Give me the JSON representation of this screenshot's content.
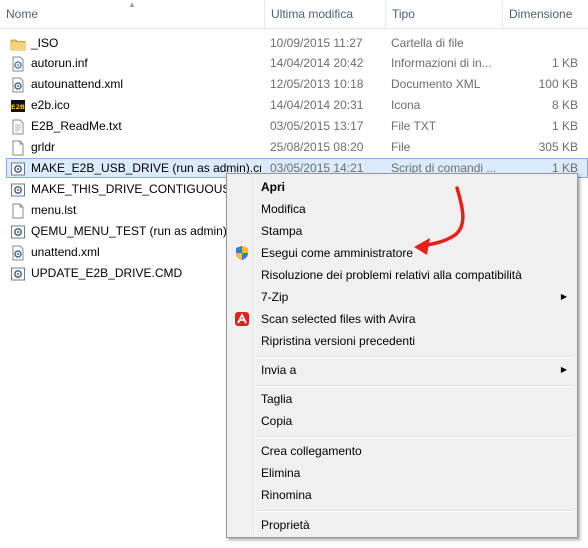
{
  "columns": {
    "name": "Nome",
    "modified": "Ultima modifica",
    "type": "Tipo",
    "size": "Dimensione"
  },
  "files": [
    {
      "name": "_ISO",
      "modified": "10/09/2015 11:27",
      "type": "Cartella di file",
      "size": "",
      "icon": "folder-icon"
    },
    {
      "name": "autorun.inf",
      "modified": "14/04/2014 20:42",
      "type": "Informazioni di in...",
      "size": "1 KB",
      "icon": "settings-file-icon"
    },
    {
      "name": "autounattend.xml",
      "modified": "12/05/2013 10:18",
      "type": "Documento XML",
      "size": "100 KB",
      "icon": "xml-file-icon"
    },
    {
      "name": "e2b.ico",
      "modified": "14/04/2014 20:31",
      "type": "Icona",
      "size": "8 KB",
      "icon": "e2b-ico-icon"
    },
    {
      "name": "E2B_ReadMe.txt",
      "modified": "03/05/2015 13:17",
      "type": "File TXT",
      "size": "1 KB",
      "icon": "text-file-icon"
    },
    {
      "name": "grldr",
      "modified": "25/08/2015 08:20",
      "type": "File",
      "size": "305 KB",
      "icon": "blank-file-icon"
    },
    {
      "name": "MAKE_E2B_USB_DRIVE (run as admin).cmd",
      "modified": "03/05/2015 14:21",
      "type": "Script di comandi ...",
      "size": "1 KB",
      "icon": "cmd-script-icon"
    },
    {
      "name": "MAKE_THIS_DRIVE_CONTIGUOUS.cmd",
      "modified": "",
      "type": "",
      "size": "",
      "icon": "cmd-script-icon"
    },
    {
      "name": "menu.lst",
      "modified": "",
      "type": "",
      "size": "",
      "icon": "blank-file-icon"
    },
    {
      "name": "QEMU_MENU_TEST (run as admin).cmd",
      "modified": "",
      "type": "",
      "size": "",
      "icon": "cmd-script-icon"
    },
    {
      "name": "unattend.xml",
      "modified": "",
      "type": "",
      "size": "",
      "icon": "xml-file-icon"
    },
    {
      "name": "UPDATE_E2B_DRIVE.CMD",
      "modified": "",
      "type": "",
      "size": "",
      "icon": "cmd-script-icon"
    }
  ],
  "context_menu": {
    "open": "Apri",
    "edit": "Modifica",
    "print": "Stampa",
    "run_as_admin": "Esegui come amministratore",
    "troubleshoot": "Risoluzione dei problemi relativi alla compatibilità",
    "seven_zip": "7-Zip",
    "avira_scan": "Scan selected files with Avira",
    "restore_versions": "Ripristina versioni precedenti",
    "send_to": "Invia a",
    "cut": "Taglia",
    "copy": "Copia",
    "create_shortcut": "Crea collegamento",
    "delete": "Elimina",
    "rename": "Rinomina",
    "properties": "Proprietà"
  },
  "colors": {
    "selection_bg": "#dcebfc",
    "selection_border": "#84acdd",
    "annotation_arrow": "#e8201c",
    "folder": "#e8c15a"
  }
}
